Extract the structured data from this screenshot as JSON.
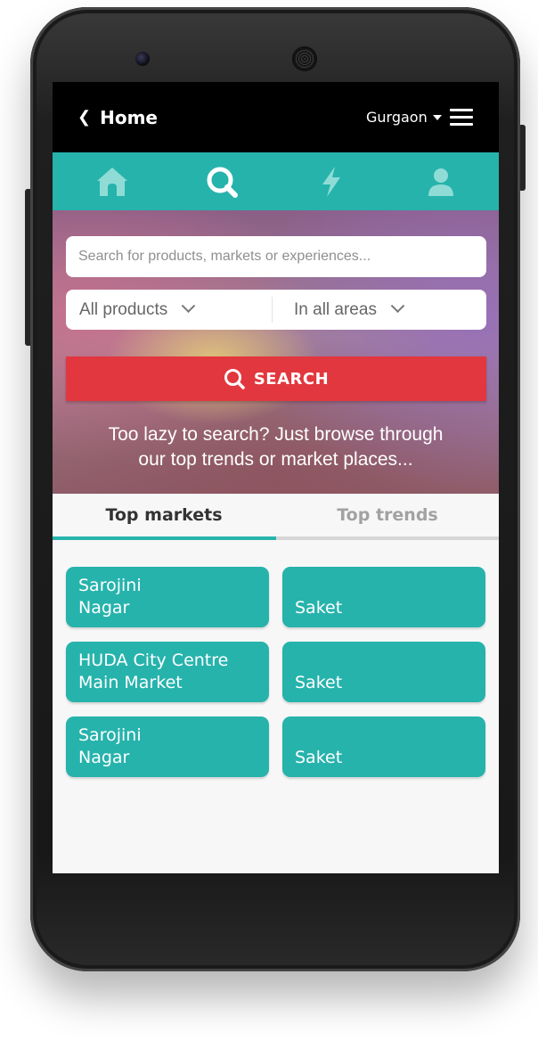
{
  "header": {
    "back_label": "Home",
    "city": "Gurgaon"
  },
  "nav": {
    "items": [
      {
        "icon": "home-icon"
      },
      {
        "icon": "search-icon"
      },
      {
        "icon": "lightning-icon"
      },
      {
        "icon": "user-icon"
      }
    ],
    "active": "search-icon"
  },
  "search": {
    "placeholder": "Search for products, markets or experiences...",
    "product_select": "All products",
    "area_select": "In all areas",
    "button_label": "SEARCH"
  },
  "tagline": {
    "line1": "Too lazy to search? Just browse through",
    "line2": "our top trends or market places..."
  },
  "tabs": {
    "top_markets": "Top markets",
    "top_trends": "Top trends",
    "active": "Top markets"
  },
  "markets": [
    {
      "line1": "Sarojini",
      "line2": "Nagar"
    },
    {
      "line1": "",
      "line2": "Saket"
    },
    {
      "line1": "HUDA City Centre",
      "line2": "Main Market"
    },
    {
      "line1": "",
      "line2": "Saket"
    },
    {
      "line1": "Sarojini",
      "line2": "Nagar"
    },
    {
      "line1": "",
      "line2": "Saket"
    }
  ],
  "colors": {
    "accent": "#26b3ac",
    "search_button": "#e2373e",
    "header_bg": "#000000"
  }
}
